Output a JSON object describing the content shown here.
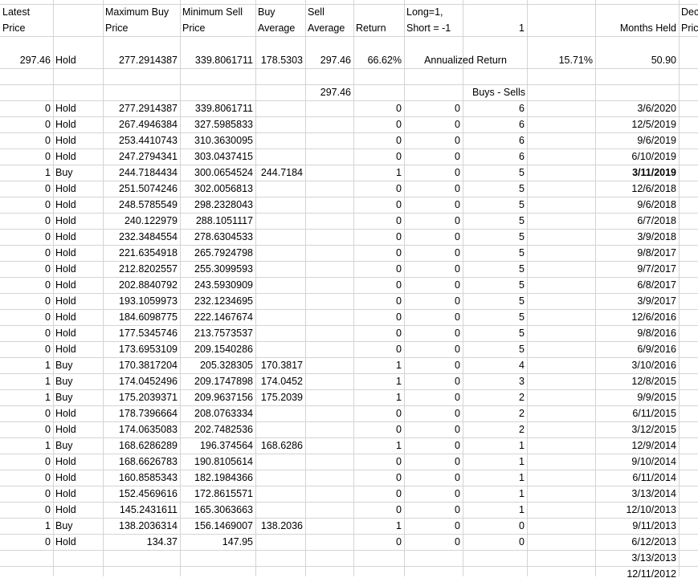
{
  "header": {
    "row1": [
      "Latest",
      "",
      "Maximum Buy",
      "Minimum Sell",
      "Buy",
      "Sell",
      "",
      "Long=1,",
      "",
      "",
      "",
      "Dec"
    ],
    "row2": [
      "Price",
      "",
      "Price",
      "Price",
      "Average",
      "Average",
      "Return",
      "Short = -1",
      "1",
      "",
      "Months Held",
      "Pric"
    ]
  },
  "summary": {
    "latest_price": "297.46",
    "signal": "Hold",
    "max_buy_price": "277.2914387",
    "min_sell_price": "339.8061711",
    "buy_average": "178.5303",
    "sell_average": "297.46",
    "return": "66.62%",
    "annualized_label": "Annualized Return",
    "annualized_value": "15.71%",
    "months_held": "50.90"
  },
  "row5": {
    "sell_average": "297.46",
    "buys_sells_label": "Buys - Sells"
  },
  "rows": [
    {
      "v": "0",
      "s": "Hold",
      "max": "277.2914387",
      "min": "339.8061711",
      "ba": "",
      "ret": "0",
      "ls": "0",
      "bs": "6",
      "date": "3/6/2020"
    },
    {
      "v": "0",
      "s": "Hold",
      "max": "267.4946384",
      "min": "327.5985833",
      "ba": "",
      "ret": "0",
      "ls": "0",
      "bs": "6",
      "date": "12/5/2019"
    },
    {
      "v": "0",
      "s": "Hold",
      "max": "253.4410743",
      "min": "310.3630095",
      "ba": "",
      "ret": "0",
      "ls": "0",
      "bs": "6",
      "date": "9/6/2019"
    },
    {
      "v": "0",
      "s": "Hold",
      "max": "247.2794341",
      "min": "303.0437415",
      "ba": "",
      "ret": "0",
      "ls": "0",
      "bs": "6",
      "date": "6/10/2019"
    },
    {
      "v": "1",
      "s": "Buy",
      "max": "244.7184434",
      "min": "300.0654524",
      "ba": "244.7184",
      "ret": "1",
      "ls": "0",
      "bs": "5",
      "date": "3/11/2019",
      "bold": true
    },
    {
      "v": "0",
      "s": "Hold",
      "max": "251.5074246",
      "min": "302.0056813",
      "ba": "",
      "ret": "0",
      "ls": "0",
      "bs": "5",
      "date": "12/6/2018"
    },
    {
      "v": "0",
      "s": "Hold",
      "max": "248.5785549",
      "min": "298.2328043",
      "ba": "",
      "ret": "0",
      "ls": "0",
      "bs": "5",
      "date": "9/6/2018"
    },
    {
      "v": "0",
      "s": "Hold",
      "max": "240.122979",
      "min": "288.1051117",
      "ba": "",
      "ret": "0",
      "ls": "0",
      "bs": "5",
      "date": "6/7/2018"
    },
    {
      "v": "0",
      "s": "Hold",
      "max": "232.3484554",
      "min": "278.6304533",
      "ba": "",
      "ret": "0",
      "ls": "0",
      "bs": "5",
      "date": "3/9/2018"
    },
    {
      "v": "0",
      "s": "Hold",
      "max": "221.6354918",
      "min": "265.7924798",
      "ba": "",
      "ret": "0",
      "ls": "0",
      "bs": "5",
      "date": "9/8/2017"
    },
    {
      "v": "0",
      "s": "Hold",
      "max": "212.8202557",
      "min": "255.3099593",
      "ba": "",
      "ret": "0",
      "ls": "0",
      "bs": "5",
      "date": "9/7/2017"
    },
    {
      "v": "0",
      "s": "Hold",
      "max": "202.8840792",
      "min": "243.5930909",
      "ba": "",
      "ret": "0",
      "ls": "0",
      "bs": "5",
      "date": "6/8/2017"
    },
    {
      "v": "0",
      "s": "Hold",
      "max": "193.1059973",
      "min": "232.1234695",
      "ba": "",
      "ret": "0",
      "ls": "0",
      "bs": "5",
      "date": "3/9/2017"
    },
    {
      "v": "0",
      "s": "Hold",
      "max": "184.6098775",
      "min": "222.1467674",
      "ba": "",
      "ret": "0",
      "ls": "0",
      "bs": "5",
      "date": "12/6/2016"
    },
    {
      "v": "0",
      "s": "Hold",
      "max": "177.5345746",
      "min": "213.7573537",
      "ba": "",
      "ret": "0",
      "ls": "0",
      "bs": "5",
      "date": "9/8/2016"
    },
    {
      "v": "0",
      "s": "Hold",
      "max": "173.6953109",
      "min": "209.1540286",
      "ba": "",
      "ret": "0",
      "ls": "0",
      "bs": "5",
      "date": "6/9/2016"
    },
    {
      "v": "1",
      "s": "Buy",
      "max": "170.3817204",
      "min": "205.328305",
      "ba": "170.3817",
      "ret": "1",
      "ls": "0",
      "bs": "4",
      "date": "3/10/2016"
    },
    {
      "v": "1",
      "s": "Buy",
      "max": "174.0452496",
      "min": "209.1747898",
      "ba": "174.0452",
      "ret": "1",
      "ls": "0",
      "bs": "3",
      "date": "12/8/2015"
    },
    {
      "v": "1",
      "s": "Buy",
      "max": "175.2039371",
      "min": "209.9637156",
      "ba": "175.2039",
      "ret": "1",
      "ls": "0",
      "bs": "2",
      "date": "9/9/2015"
    },
    {
      "v": "0",
      "s": "Hold",
      "max": "178.7396664",
      "min": "208.0763334",
      "ba": "",
      "ret": "0",
      "ls": "0",
      "bs": "2",
      "date": "6/11/2015"
    },
    {
      "v": "0",
      "s": "Hold",
      "max": "174.0635083",
      "min": "202.7482536",
      "ba": "",
      "ret": "0",
      "ls": "0",
      "bs": "2",
      "date": "3/12/2015"
    },
    {
      "v": "1",
      "s": "Buy",
      "max": "168.6286289",
      "min": "196.374564",
      "ba": "168.6286",
      "ret": "1",
      "ls": "0",
      "bs": "1",
      "date": "12/9/2014"
    },
    {
      "v": "0",
      "s": "Hold",
      "max": "168.6626783",
      "min": "190.8105614",
      "ba": "",
      "ret": "0",
      "ls": "0",
      "bs": "1",
      "date": "9/10/2014"
    },
    {
      "v": "0",
      "s": "Hold",
      "max": "160.8585343",
      "min": "182.1984366",
      "ba": "",
      "ret": "0",
      "ls": "0",
      "bs": "1",
      "date": "6/11/2014"
    },
    {
      "v": "0",
      "s": "Hold",
      "max": "152.4569616",
      "min": "172.8615571",
      "ba": "",
      "ret": "0",
      "ls": "0",
      "bs": "1",
      "date": "3/13/2014"
    },
    {
      "v": "0",
      "s": "Hold",
      "max": "145.2431611",
      "min": "165.3063663",
      "ba": "",
      "ret": "0",
      "ls": "0",
      "bs": "1",
      "date": "12/10/2013"
    },
    {
      "v": "1",
      "s": "Buy",
      "max": "138.2036314",
      "min": "156.1469007",
      "ba": "138.2036",
      "ret": "1",
      "ls": "0",
      "bs": "0",
      "date": "9/11/2013"
    },
    {
      "v": "0",
      "s": "Hold",
      "max": "134.37",
      "min": "147.95",
      "ba": "",
      "ret": "0",
      "ls": "0",
      "bs": "0",
      "date": "6/12/2013"
    },
    {
      "v": "",
      "s": "",
      "max": "",
      "min": "",
      "ba": "",
      "ret": "",
      "ls": "",
      "bs": "",
      "date": "3/13/2013"
    },
    {
      "v": "",
      "s": "",
      "max": "",
      "min": "",
      "ba": "",
      "ret": "",
      "ls": "",
      "bs": "",
      "date": "12/11/2012"
    }
  ]
}
